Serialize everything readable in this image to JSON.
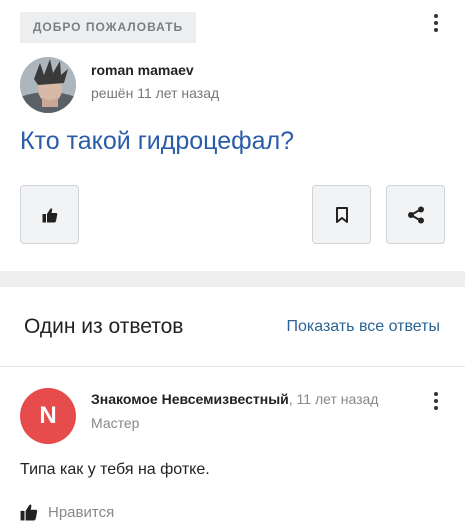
{
  "question": {
    "badge": "ДОБРО ПОЖАЛОВАТЬ",
    "author": "roman mamaev",
    "meta": "решён 11 лет назад",
    "title": "Кто такой гидроцефал?"
  },
  "answers_section": {
    "header": "Один из ответов",
    "show_all": "Показать все ответы"
  },
  "answer": {
    "avatar_letter": "N",
    "author": "Знакомое Невсемизвестный",
    "time": ", 11 лет назад",
    "rank": "Мастер",
    "text": "Типа как у тебя на фотке.",
    "like_label": "Нравится"
  },
  "colors": {
    "link": "#2a5ca8",
    "avatar_bg": "#e74c4c",
    "badge_bg": "#eceeef"
  },
  "icons": [
    "more-vertical-icon",
    "thumbs-up-icon",
    "bookmark-icon",
    "share-icon"
  ]
}
